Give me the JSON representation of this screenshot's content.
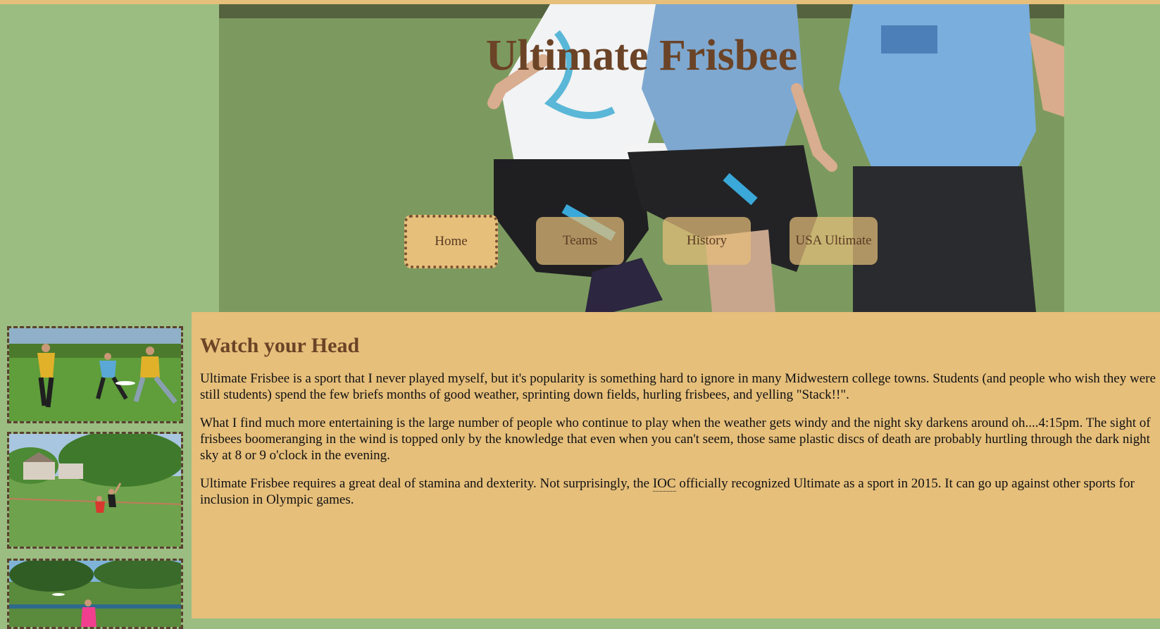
{
  "header": {
    "title": "Ultimate Frisbee",
    "nav": [
      {
        "label": "Home",
        "active": true
      },
      {
        "label": "Teams",
        "active": false
      },
      {
        "label": "History",
        "active": false
      },
      {
        "label": "USA Ultimate",
        "active": false
      }
    ]
  },
  "article": {
    "heading": "Watch your Head",
    "p1": "Ultimate Frisbee is a sport that I never played myself, but it's popularity is something hard to ignore in many Midwestern college towns. Students (and people who wish they were still students) spend the few briefs months of good weather, sprinting down fields, hurling frisbees, and yelling \"Stack!!\".",
    "p2": "What I find much more entertaining is the large number of people who continue to play when the weather gets windy and the night sky darkens around oh....4:15pm. The sight of frisbees boomeranging in the wind is topped only by the knowledge that even when you can't seem, those same plastic discs of death are probably hurtling through the dark night sky at 8 or 9 o'clock in the evening.",
    "p3_before": "Ultimate Frisbee requires a great deal of stamina and dexterity. Not surprisingly, the ",
    "p3_abbr": "IOC",
    "p3_after": " officially recognized Ultimate as a sport in 2015. It can go up against other sports for inclusion in Olympic games."
  },
  "colors": {
    "page_green": "#9bbd82",
    "tan": "#e6bf7b",
    "brown_title": "#6b4326"
  }
}
